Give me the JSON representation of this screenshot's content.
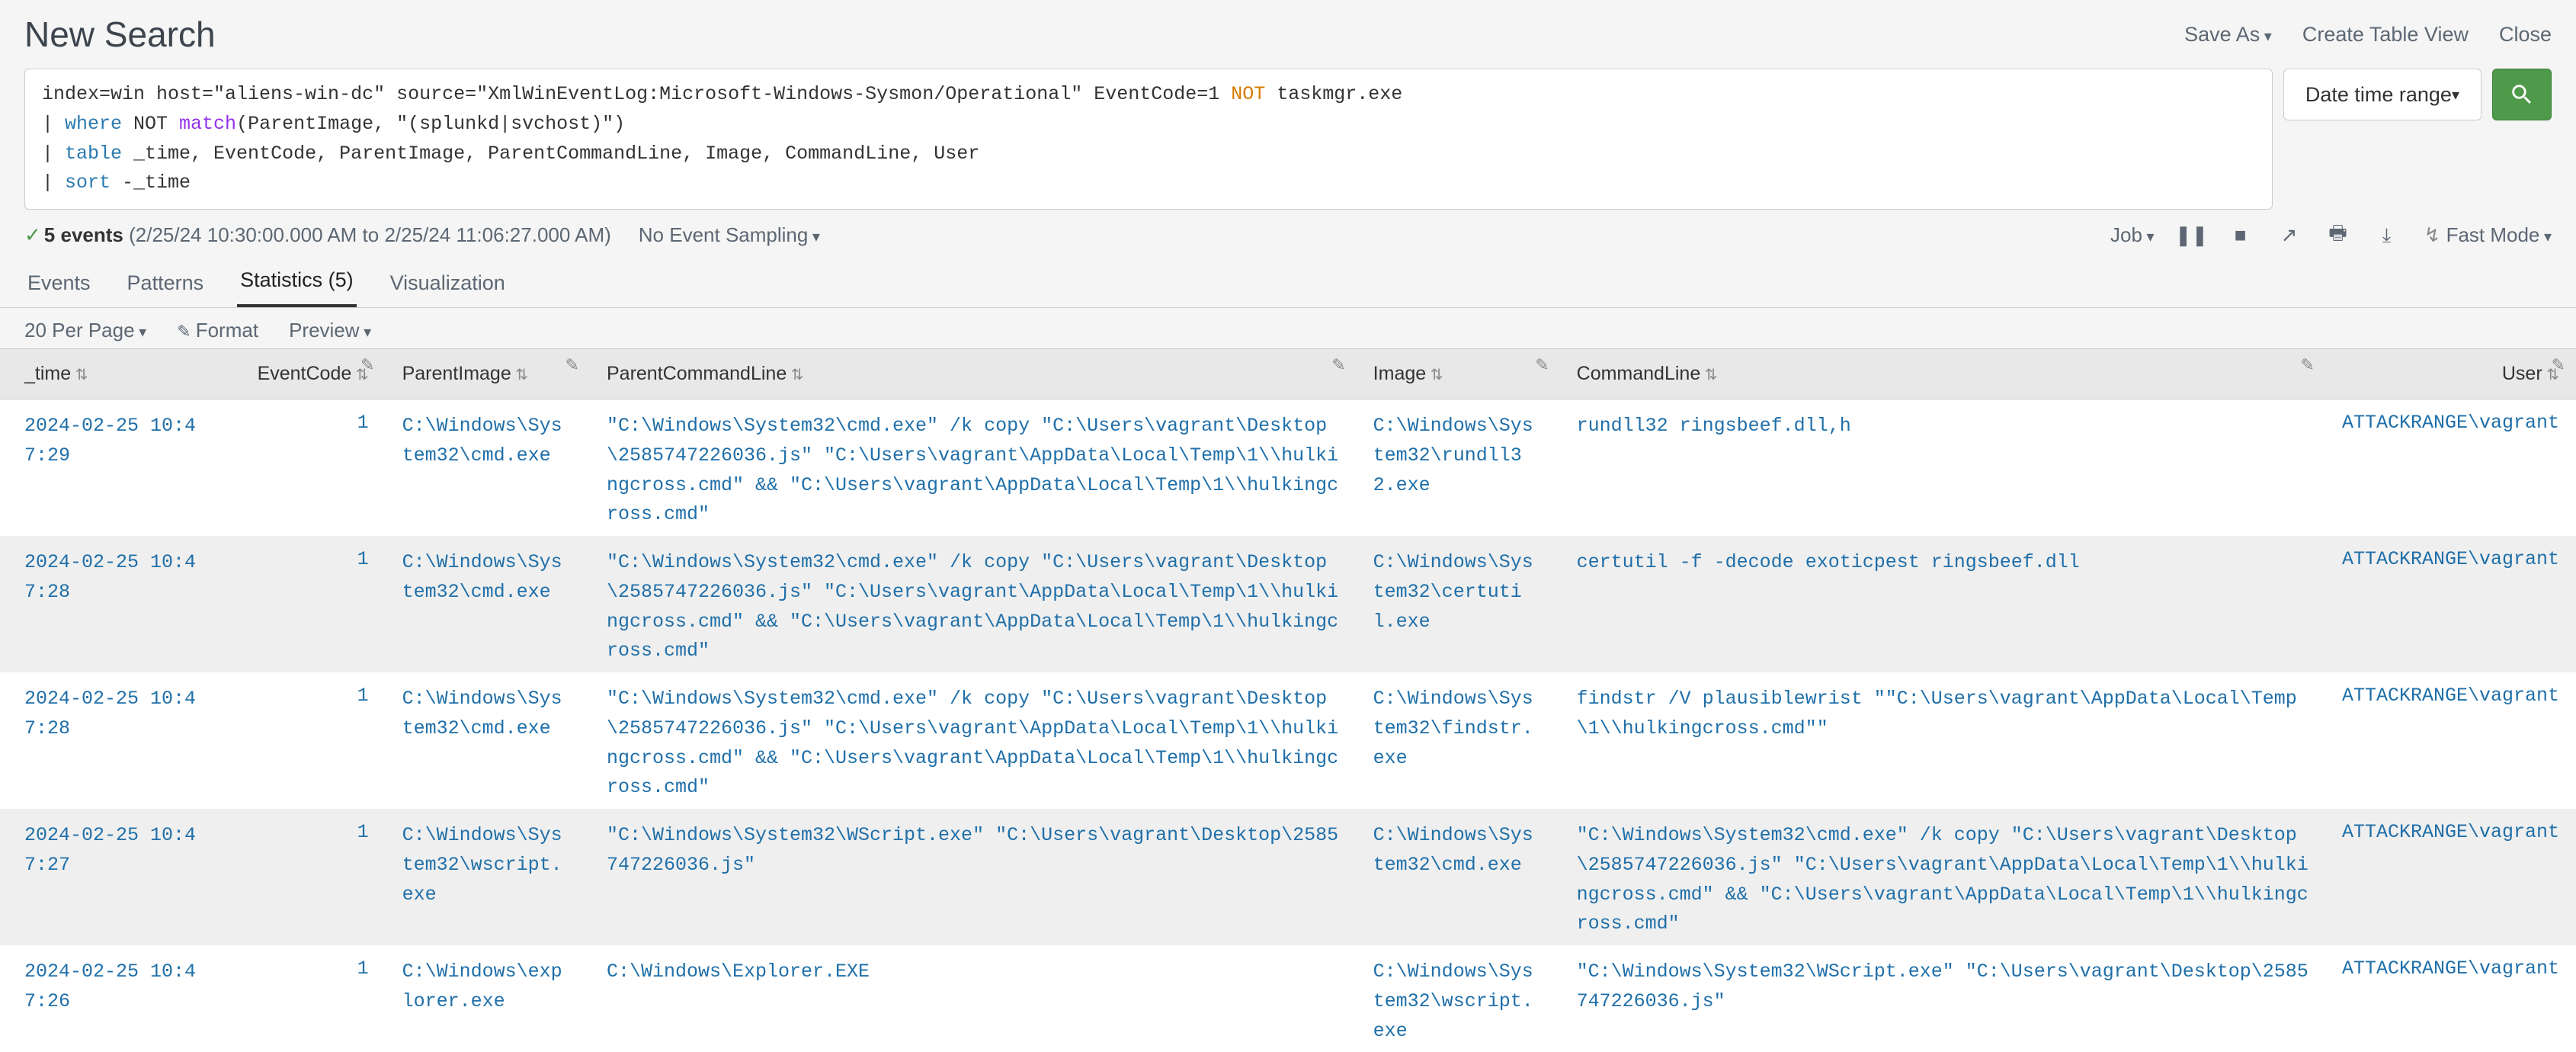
{
  "page": {
    "title": "New Search",
    "actions": {
      "save_as": "Save As",
      "create_table_view": "Create Table View",
      "close": "Close"
    }
  },
  "search": {
    "query_parts": {
      "l1_pre": "index=win host=\"aliens-win-dc\" source=\"XmlWinEventLog:Microsoft-Windows-Sysmon/Operational\" EventCode=1 ",
      "l1_not": "NOT",
      "l1_post": " taskmgr.exe",
      "l2_pipe": "| ",
      "l2_where": "where",
      "l2_mid": " NOT ",
      "l2_match": "match",
      "l2_tail": "(ParentImage, \"(splunkd|svchost)\")",
      "l3_pipe": "| ",
      "l3_table": "table",
      "l3_tail": " _time, EventCode, ParentImage, ParentCommandLine, Image, CommandLine, User",
      "l4_pipe": "| ",
      "l4_sort": "sort",
      "l4_tail": " -_time"
    },
    "time_range_label": "Date time range",
    "search_button_aria": "Search"
  },
  "status": {
    "event_count_label": "5 events",
    "time_range_text": "(2/25/24 10:30:00.000 AM to 2/25/24 11:06:27.000 AM)",
    "sampling_label": "No Event Sampling",
    "job_label": "Job",
    "fast_mode_label": "Fast Mode"
  },
  "tabs": {
    "events": "Events",
    "patterns": "Patterns",
    "statistics": "Statistics (5)",
    "visualization": "Visualization"
  },
  "toolbar": {
    "per_page": "20 Per Page",
    "format": "Format",
    "preview": "Preview"
  },
  "columns": {
    "time": "_time",
    "event_code": "EventCode",
    "parent_image": "ParentImage",
    "parent_cmdline": "ParentCommandLine",
    "image": "Image",
    "cmdline": "CommandLine",
    "user": "User"
  },
  "rows": [
    {
      "time": "2024-02-25 10:47:29",
      "event_code": "1",
      "parent_image": "C:\\Windows\\System32\\cmd.exe",
      "parent_cmdline": "\"C:\\Windows\\System32\\cmd.exe\" /k copy \"C:\\Users\\vagrant\\Desktop\\2585747226036.js\" \"C:\\Users\\vagrant\\AppData\\Local\\Temp\\1\\\\hulkingcross.cmd\" &amp;&amp; \"C:\\Users\\vagrant\\AppData\\Local\\Temp\\1\\\\hulkingcross.cmd\"",
      "image": "C:\\Windows\\System32\\rundll32.exe",
      "cmdline": "rundll32  ringsbeef.dll,h",
      "user": "ATTACKRANGE\\vagrant"
    },
    {
      "time": "2024-02-25 10:47:28",
      "event_code": "1",
      "parent_image": "C:\\Windows\\System32\\cmd.exe",
      "parent_cmdline": "\"C:\\Windows\\System32\\cmd.exe\" /k copy \"C:\\Users\\vagrant\\Desktop\\2585747226036.js\" \"C:\\Users\\vagrant\\AppData\\Local\\Temp\\1\\\\hulkingcross.cmd\" &amp;&amp; \"C:\\Users\\vagrant\\AppData\\Local\\Temp\\1\\\\hulkingcross.cmd\"",
      "image": "C:\\Windows\\System32\\certutil.exe",
      "cmdline": "certutil  -f -decode exoticpest ringsbeef.dll",
      "user": "ATTACKRANGE\\vagrant"
    },
    {
      "time": "2024-02-25 10:47:28",
      "event_code": "1",
      "parent_image": "C:\\Windows\\System32\\cmd.exe",
      "parent_cmdline": "\"C:\\Windows\\System32\\cmd.exe\" /k copy \"C:\\Users\\vagrant\\Desktop\\2585747226036.js\" \"C:\\Users\\vagrant\\AppData\\Local\\Temp\\1\\\\hulkingcross.cmd\" &amp;&amp; \"C:\\Users\\vagrant\\AppData\\Local\\Temp\\1\\\\hulkingcross.cmd\"",
      "image": "C:\\Windows\\System32\\findstr.exe",
      "cmdline": "findstr  /V plausiblewrist \"\"C:\\Users\\vagrant\\AppData\\Local\\Temp\\1\\\\hulkingcross.cmd\"\"",
      "user": "ATTACKRANGE\\vagrant"
    },
    {
      "time": "2024-02-25 10:47:27",
      "event_code": "1",
      "parent_image": "C:\\Windows\\System32\\wscript.exe",
      "parent_cmdline": "\"C:\\Windows\\System32\\WScript.exe\" \"C:\\Users\\vagrant\\Desktop\\2585747226036.js\"",
      "image": "C:\\Windows\\System32\\cmd.exe",
      "cmdline": "\"C:\\Windows\\System32\\cmd.exe\" /k copy \"C:\\Users\\vagrant\\Desktop\\2585747226036.js\" \"C:\\Users\\vagrant\\AppData\\Local\\Temp\\1\\\\hulkingcross.cmd\" &amp;&amp; \"C:\\Users\\vagrant\\AppData\\Local\\Temp\\1\\\\hulkingcross.cmd\"",
      "user": "ATTACKRANGE\\vagrant"
    },
    {
      "time": "2024-02-25 10:47:26",
      "event_code": "1",
      "parent_image": "C:\\Windows\\explorer.exe",
      "parent_cmdline": "C:\\Windows\\Explorer.EXE",
      "image": "C:\\Windows\\System32\\wscript.exe",
      "cmdline": "\"C:\\Windows\\System32\\WScript.exe\" \"C:\\Users\\vagrant\\Desktop\\2585747226036.js\"",
      "user": "ATTACKRANGE\\vagrant"
    }
  ]
}
